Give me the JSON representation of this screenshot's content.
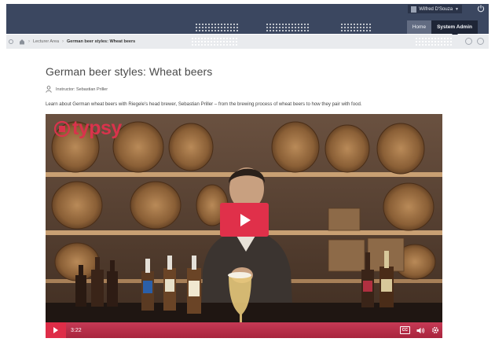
{
  "header": {
    "user_name": "Wilfred D'Souza",
    "nav": [
      {
        "label": "Home"
      },
      {
        "label": "System Admin"
      }
    ]
  },
  "breadcrumb": {
    "items": [
      "Lecturer Area",
      "German beer styles: Wheat beers"
    ]
  },
  "page": {
    "title": "German beer styles: Wheat beers",
    "instructor": "Instructor: Sebastian Priller",
    "description": "Learn about German wheat beers with Riegele's head brewer, Sebastian Priller – from the brewing process of wheat beers to how they pair with food."
  },
  "video": {
    "brand": "typsy",
    "time": "3:22",
    "cc_label": "CC",
    "accent_color": "#e0304a"
  }
}
